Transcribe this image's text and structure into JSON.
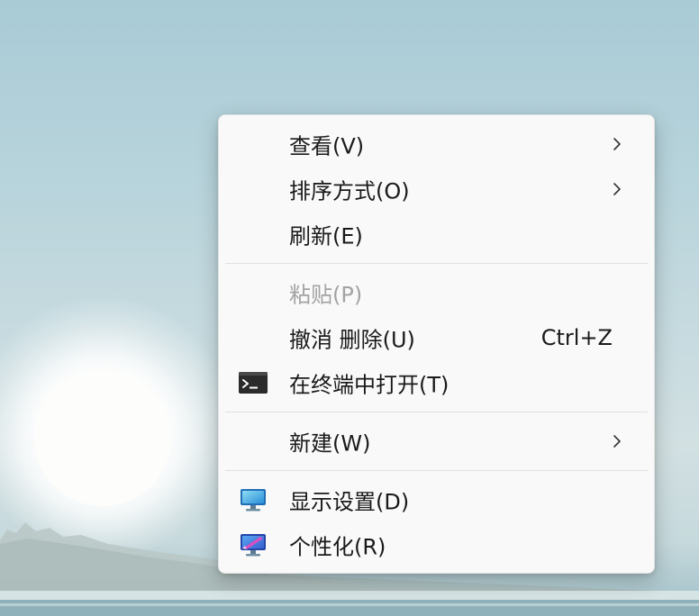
{
  "context_menu": {
    "items": [
      {
        "label": "查看(V)"
      },
      {
        "label": "排序方式(O)"
      },
      {
        "label": "刷新(E)"
      },
      {
        "label": "粘贴(P)"
      },
      {
        "label": "撤消 删除(U)",
        "shortcut": "Ctrl+Z"
      },
      {
        "label": "在终端中打开(T)",
        "icon": "terminal-icon"
      },
      {
        "label": "新建(W)"
      },
      {
        "label": "显示设置(D)",
        "icon": "display-settings-icon"
      },
      {
        "label": "个性化(R)",
        "icon": "personalize-icon"
      }
    ]
  },
  "colors": {
    "menu_background": "#f9f9f9",
    "text": "#1a1a1a",
    "disabled_text": "#a3a3a3",
    "separator": "#e0e0e0"
  }
}
